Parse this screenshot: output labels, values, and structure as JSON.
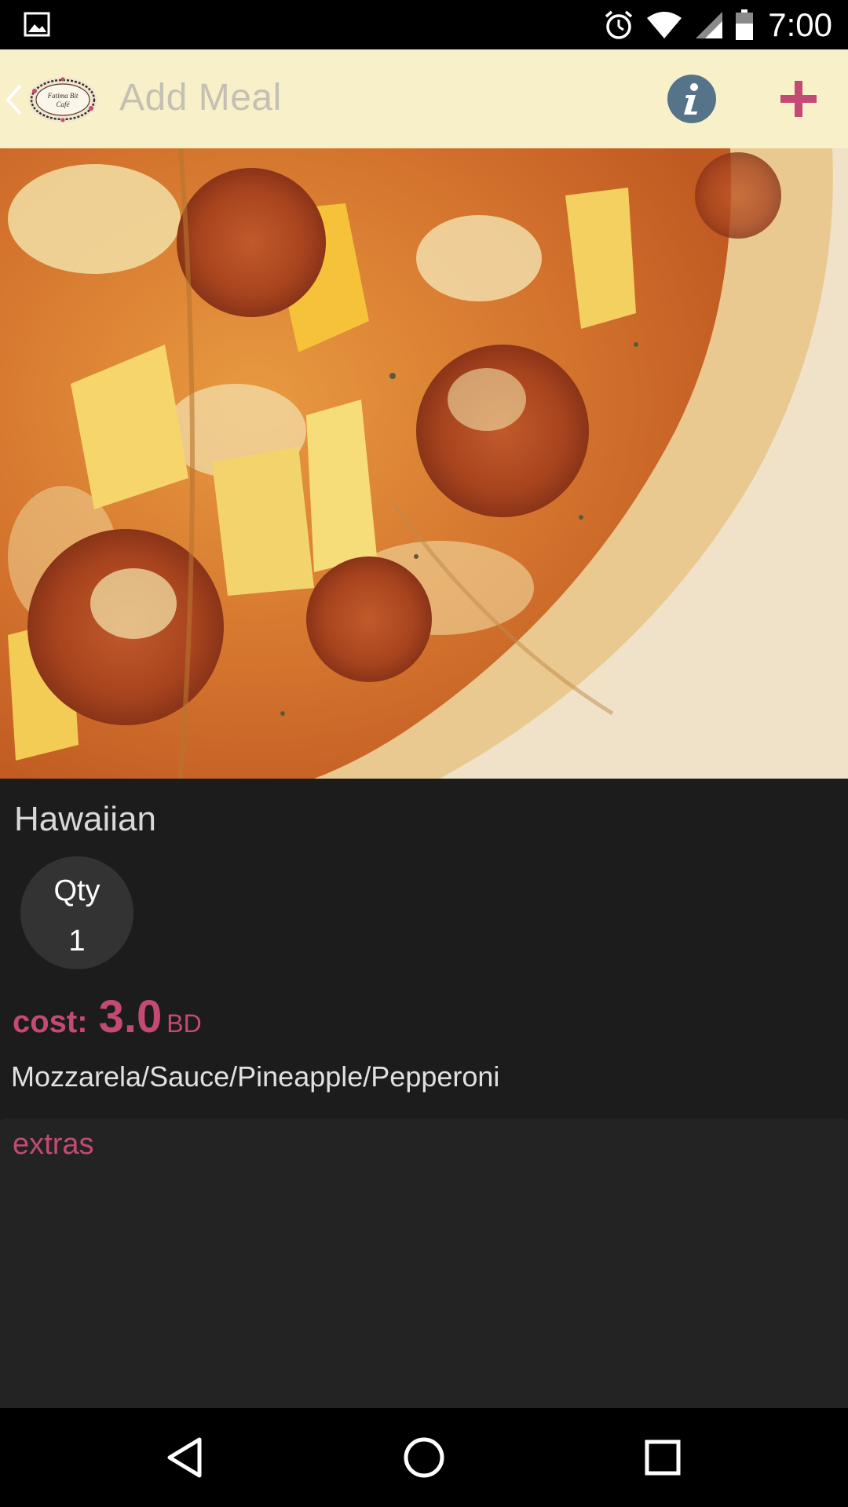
{
  "status_bar": {
    "time": "7:00",
    "icons": [
      "gallery-icon",
      "alarm-icon",
      "wifi-icon",
      "signal-icon",
      "battery-icon"
    ]
  },
  "app_bar": {
    "title": "Add Meal",
    "logo_text_line1": "Fatima Bit",
    "logo_text_line2": "Café",
    "icons": [
      "back-icon",
      "info-icon",
      "add-icon"
    ],
    "accent_color": "#c44a76",
    "background_color": "#f8f0c8"
  },
  "meal": {
    "name": "Hawaiian",
    "qty_label": "Qty",
    "qty_value": "1",
    "cost_label": "cost:",
    "cost_value": "3.0",
    "currency": "BD",
    "ingredients": "Mozzarela/Sauce/Pineapple/Pepperoni"
  },
  "extras": {
    "label": "extras"
  },
  "nav_bar": {
    "icons": [
      "back-triangle-icon",
      "home-circle-icon",
      "recents-square-icon"
    ]
  }
}
